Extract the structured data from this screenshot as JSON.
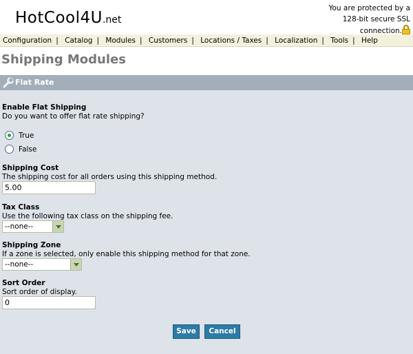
{
  "header": {
    "logo_main": "HotCool4U",
    "logo_tld": ".net",
    "ssl_line1": "You are protected by a",
    "ssl_line2": "128-bit secure SSL",
    "ssl_line3": "connection."
  },
  "menu": {
    "items": [
      "Configuration",
      "Catalog",
      "Modules",
      "Customers",
      "Locations / Taxes",
      "Localization",
      "Tools",
      "Help"
    ],
    "separator": "|"
  },
  "page_title": "Shipping Modules",
  "panel": {
    "title": "Flat Rate",
    "enable": {
      "title": "Enable Flat Shipping",
      "desc": "Do you want to offer flat rate shipping?",
      "options": [
        "True",
        "False"
      ],
      "selected": "True"
    },
    "cost": {
      "title": "Shipping Cost",
      "desc": "The shipping cost for all orders using this shipping method.",
      "value": "5.00"
    },
    "tax": {
      "title": "Tax Class",
      "desc": "Use the following tax class on the shipping fee.",
      "value": "--none--"
    },
    "zone": {
      "title": "Shipping Zone",
      "desc": "If a zone is selected, only enable this shipping method for that zone.",
      "value": "--none--"
    },
    "sort": {
      "title": "Sort Order",
      "desc": "Sort order of display.",
      "value": "0"
    },
    "save_label": "Save",
    "cancel_label": "Cancel"
  },
  "colors": {
    "menu_bg": "#f3f0dc",
    "panel_bg": "#dde3e8",
    "panel_header": "#a3aebb",
    "button": "#2d7ba6",
    "title_gray": "#777777"
  }
}
